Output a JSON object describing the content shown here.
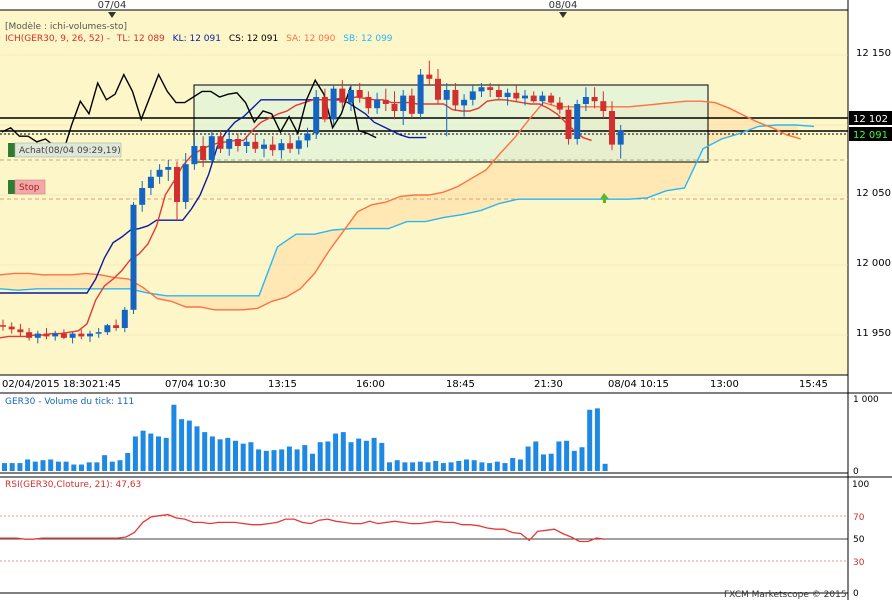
{
  "top_dates": [
    "07/04",
    "08/04"
  ],
  "price_panel": {
    "model": "[Modèle : ichi-volumes-sto]",
    "ichimoku": {
      "label": "ICH(GER30, 9, 26, 52) -",
      "tl": "TL: 12 089",
      "kl": "KL: 12 091",
      "cs": "CS: 12 091",
      "sa": "SA: 12 090",
      "sb": "SB: 12 099"
    },
    "y_ticks": [
      "12 150",
      "12 100",
      "12 050",
      "12 000",
      "11 950"
    ],
    "price_tags": [
      {
        "text": "12 102",
        "color": "#000000",
        "text_color": "#ffffff"
      },
      {
        "text": "12 091",
        "color": "#000000",
        "text_color": "#33ff33"
      }
    ],
    "buy_label": "Achat(08/04 09:29,19)",
    "stop_label": "Stop",
    "x_ticks": [
      "02/04/2015 18:30",
      "21:45",
      "07/04 10:30",
      "13:15",
      "16:00",
      "18:45",
      "21:30",
      "08/04 10:15",
      "13:00",
      "15:45"
    ]
  },
  "volume_panel": {
    "label": "GER30 - Volume du tick: 111",
    "y_ticks": [
      "1 000",
      "0"
    ]
  },
  "rsi_panel": {
    "label": "RSI(GER30,Cloture, 21): 47,63",
    "y_ticks": [
      "100",
      "70",
      "50",
      "30",
      "0"
    ]
  },
  "footer": "FXCM Marketscope © 2015",
  "colors": {
    "background": "#fdf6c8",
    "up": "#1565c0",
    "down": "#d32f2f",
    "tenkan": "#e53935",
    "kijun": "#0d1a9e",
    "chikou": "#000000",
    "senkou_a": "#ff7043",
    "senkou_b": "#29b6f6",
    "cloud": "#ffe0a6",
    "rsi": "#e53935",
    "volume": "#1e88e5"
  },
  "chart_data": [
    {
      "type": "candlestick",
      "title": "GER30",
      "ylim": [
        11930,
        12170
      ],
      "x_ticks": [
        "02/04/2015 18:30",
        "21:45",
        "07/04 10:30",
        "13:15",
        "16:00",
        "18:45",
        "21:30",
        "08/04 10:15",
        "13:00",
        "15:45"
      ],
      "candles_ohlc": [
        [
          11957,
          11961,
          11953,
          11956
        ],
        [
          11956,
          11959,
          11951,
          11954
        ],
        [
          11954,
          11958,
          11949,
          11952
        ],
        [
          11952,
          11955,
          11946,
          11948
        ],
        [
          11948,
          11953,
          11944,
          11951
        ],
        [
          11951,
          11955,
          11947,
          11949
        ],
        [
          11949,
          11953,
          11946,
          11951
        ],
        [
          11951,
          11954,
          11947,
          11948
        ],
        [
          11948,
          11952,
          11944,
          11951
        ],
        [
          11951,
          11954,
          11947,
          11949
        ],
        [
          11949,
          11953,
          11945,
          11951
        ],
        [
          11951,
          11955,
          11948,
          11952
        ],
        [
          11952,
          11958,
          11950,
          11957
        ],
        [
          11957,
          11961,
          11953,
          11955
        ],
        [
          11955,
          11970,
          11952,
          11968
        ],
        [
          11968,
          12045,
          11965,
          12043
        ],
        [
          12043,
          12060,
          12038,
          12055
        ],
        [
          12055,
          12068,
          12050,
          12063
        ],
        [
          12063,
          12072,
          12058,
          12068
        ],
        [
          12068,
          12075,
          12060,
          12070
        ],
        [
          12070,
          12074,
          12032,
          12045
        ],
        [
          12045,
          12080,
          12040,
          12072
        ],
        [
          12072,
          12090,
          12068,
          12085
        ],
        [
          12085,
          12092,
          12070,
          12075
        ],
        [
          12075,
          12096,
          12073,
          12092
        ],
        [
          12092,
          12096,
          12080,
          12083
        ],
        [
          12083,
          12095,
          12078,
          12090
        ],
        [
          12090,
          12094,
          12081,
          12085
        ],
        [
          12085,
          12092,
          12080,
          12088
        ],
        [
          12088,
          12094,
          12080,
          12083
        ],
        [
          12083,
          12090,
          12077,
          12086
        ],
        [
          12086,
          12092,
          12078,
          12082
        ],
        [
          12082,
          12090,
          12076,
          12087
        ],
        [
          12087,
          12093,
          12080,
          12083
        ],
        [
          12083,
          12092,
          12079,
          12089
        ],
        [
          12089,
          12098,
          12084,
          12094
        ],
        [
          12094,
          12125,
          12090,
          12120
        ],
        [
          12120,
          12126,
          12102,
          12104
        ],
        [
          12104,
          12128,
          12100,
          12126
        ],
        [
          12126,
          12132,
          12112,
          12116
        ],
        [
          12116,
          12128,
          12110,
          12125
        ],
        [
          12125,
          12130,
          12116,
          12120
        ],
        [
          12120,
          12124,
          12108,
          12112
        ],
        [
          12112,
          12123,
          12108,
          12118
        ],
        [
          12118,
          12126,
          12110,
          12115
        ],
        [
          12115,
          12124,
          12104,
          12110
        ],
        [
          12110,
          12125,
          12100,
          12121
        ],
        [
          12121,
          12126,
          12105,
          12108
        ],
        [
          12108,
          12140,
          12104,
          12136
        ],
        [
          12136,
          12146,
          12128,
          12133
        ],
        [
          12133,
          12140,
          12115,
          12118
        ],
        [
          12118,
          12130,
          12092,
          12125
        ],
        [
          12125,
          12130,
          12110,
          12114
        ],
        [
          12114,
          12122,
          12106,
          12118
        ],
        [
          12118,
          12128,
          12114,
          12124
        ],
        [
          12124,
          12130,
          12120,
          12127
        ],
        [
          12127,
          12130,
          12120,
          12125
        ],
        [
          12125,
          12128,
          12118,
          12120
        ],
        [
          12120,
          12126,
          12114,
          12123
        ],
        [
          12123,
          12128,
          12117,
          12119
        ],
        [
          12119,
          12125,
          12114,
          12121
        ],
        [
          12121,
          12124,
          12116,
          12117
        ],
        [
          12117,
          12124,
          12114,
          12121
        ],
        [
          12121,
          12123,
          12114,
          12116
        ],
        [
          12116,
          12120,
          12108,
          12111
        ],
        [
          12111,
          12114,
          12086,
          12090
        ],
        [
          12090,
          12118,
          12086,
          12115
        ],
        [
          12115,
          12127,
          12110,
          12120
        ],
        [
          12120,
          12127,
          12112,
          12117
        ],
        [
          12117,
          12124,
          12105,
          12110
        ],
        [
          12110,
          12117,
          12082,
          12086
        ],
        [
          12086,
          12100,
          12076,
          12096
        ]
      ],
      "series": [
        {
          "name": "TL",
          "values": [
            11948,
            11949,
            11949,
            11949,
            11950,
            11950,
            11951,
            11951,
            11952,
            11953,
            11958,
            11975,
            11985,
            11990,
            11996,
            12004,
            12008,
            12015,
            12028,
            12050,
            12060,
            12071,
            12078,
            12082,
            12085,
            12087,
            12088,
            12089,
            12089,
            12096,
            12102,
            12105,
            12108,
            12110,
            12114,
            12116,
            12118,
            12118,
            12118,
            12119,
            12119,
            12120,
            12119,
            12118,
            12118,
            12116,
            12116,
            12116,
            12115,
            12115,
            12115,
            12115,
            12111,
            12110,
            12110,
            12112,
            12117,
            12118,
            12118,
            12117,
            12116,
            12115,
            12115,
            12112,
            12108,
            12102,
            12096,
            12091,
            12089
          ]
        },
        {
          "name": "KL",
          "values": [
            11980,
            11980,
            11980,
            11980,
            11980,
            11980,
            11980,
            11980,
            11980,
            11980,
            11980,
            11990,
            12005,
            12016,
            12020,
            12025,
            12026,
            12028,
            12032,
            12032,
            12032,
            12032,
            12040,
            12050,
            12065,
            12085,
            12095,
            12102,
            12106,
            12112,
            12118,
            12118,
            12118,
            12118,
            12118,
            12118,
            12118,
            12118,
            12118,
            12118,
            12116,
            12112,
            12108,
            12102,
            12099,
            12096,
            12093,
            12091,
            12091,
            12091
          ]
        },
        {
          "name": "CS",
          "values": [
            12095,
            12098,
            12092,
            12092,
            12088,
            12090,
            12085,
            12080,
            12100,
            12117,
            12108,
            12130,
            12118,
            12122,
            12136,
            12124,
            12104,
            12120,
            12136,
            12124,
            12116,
            12116,
            12120,
            12124,
            12124,
            12120,
            12122,
            12123,
            12116,
            12102,
            12110,
            12108,
            12095,
            12106,
            12094,
            12118,
            12132,
            12122,
            12098,
            12108,
            12126,
            12096,
            12094,
            12091
          ]
        },
        {
          "name": "SA",
          "values": [
            11993,
            11994,
            11994,
            11993,
            11993,
            11993,
            11994,
            11993,
            11991,
            11990,
            11984,
            11976,
            11974,
            11970,
            11970,
            11968,
            11968,
            11968,
            11969,
            11974,
            11977,
            11983,
            11994,
            12010,
            12024,
            12038,
            12043,
            12045,
            12049,
            12050,
            12050,
            12052,
            12056,
            12062,
            12068,
            12080,
            12091,
            12104,
            12116,
            12113,
            12113,
            12113,
            12113,
            12113,
            12113,
            12114,
            12115,
            12116,
            12117,
            12117,
            12116,
            12112,
            12107,
            12102,
            12098,
            12093,
            12090
          ]
        },
        {
          "name": "SB",
          "values": [
            11983,
            11982,
            11983,
            11983,
            11983,
            11983,
            11983,
            11983,
            11980,
            11978,
            11978,
            11978,
            11978,
            11978,
            11978,
            12013,
            12022,
            12022,
            12025,
            12026,
            12026,
            12026,
            12031,
            12031,
            12034,
            12036,
            12039,
            12044,
            12047,
            12047,
            12047,
            12047,
            12047,
            12047,
            12047,
            12048,
            12053,
            12055,
            12083,
            12090,
            12094,
            12099,
            12100,
            12100,
            12099
          ]
        }
      ]
    },
    {
      "type": "bar",
      "title": "GER30 - Volume du tick: 111",
      "ylim": [
        0,
        1000
      ],
      "values": [
        110,
        110,
        110,
        160,
        130,
        150,
        160,
        130,
        130,
        90,
        90,
        120,
        120,
        220,
        130,
        150,
        250,
        480,
        560,
        520,
        480,
        460,
        920,
        720,
        700,
        620,
        540,
        480,
        440,
        460,
        420,
        380,
        400,
        300,
        280,
        290,
        300,
        340,
        300,
        360,
        240,
        400,
        410,
        520,
        540,
        400,
        450,
        420,
        460,
        390,
        120,
        150,
        120,
        120,
        130,
        120,
        140,
        110,
        120,
        140,
        160,
        150,
        120,
        110,
        130,
        110,
        180,
        160,
        340,
        410,
        230,
        240,
        410,
        420,
        280,
        330,
        850,
        870,
        100
      ]
    },
    {
      "type": "line",
      "title": "RSI(GER30,Cloture, 21): 47,63",
      "ylim": [
        0,
        100
      ],
      "values": [
        49,
        49,
        49,
        48,
        48,
        49,
        49,
        49,
        49,
        49,
        49,
        49,
        49,
        49,
        49,
        50,
        54,
        63,
        68,
        69,
        70,
        67,
        66,
        63,
        63,
        62,
        63,
        63,
        63,
        62,
        61,
        61,
        62,
        63,
        66,
        66,
        63,
        62,
        65,
        66,
        64,
        63,
        62,
        62,
        64,
        62,
        63,
        64,
        63,
        62,
        62,
        63,
        64,
        63,
        63,
        61,
        61,
        60,
        58,
        57,
        57,
        54,
        53,
        47,
        55,
        56,
        57,
        53,
        50,
        46,
        46,
        49,
        48
      ]
    }
  ]
}
